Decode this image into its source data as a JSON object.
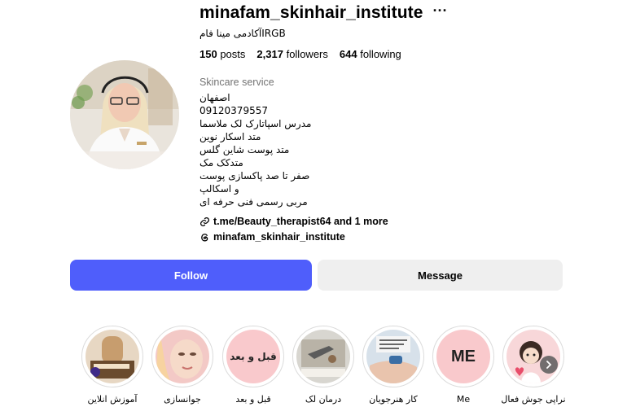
{
  "profile": {
    "username": "minafam_skinhair_institute",
    "full_name": "آکادمی مینا فامIRGB",
    "stats": {
      "posts_count": "150",
      "posts_label": "posts",
      "followers_count": "2,317",
      "followers_label": "followers",
      "following_count": "644",
      "following_label": "following"
    },
    "category": "Skincare service",
    "bio_lines": [
      "اصفهان",
      "09120379557",
      "مدرس اسپاتارک لک ملاسما",
      "متد اسکار نوین",
      "متد پوست شاین گلس",
      "متدکک مک",
      "صفر تا صد پاکسازی پوست",
      "و اسکالپ",
      "مربی رسمی فنی حرفه ای"
    ],
    "link_text": "t.me/Beauty_therapist64 and 1 more",
    "threads_handle": "minafam_skinhair_institute"
  },
  "actions": {
    "follow_label": "Follow",
    "message_label": "Message"
  },
  "highlights": [
    {
      "label": "آموزش انلاین"
    },
    {
      "label": "جوانسازی"
    },
    {
      "label": "قبل و بعد",
      "cover_text": "قبل و بعد"
    },
    {
      "label": "درمان لک"
    },
    {
      "label": "کار هنرجویان"
    },
    {
      "label": "Me",
      "cover_text": "ME"
    },
    {
      "label": "نراپی جوش فعال"
    }
  ],
  "icons": {
    "more": "more-options-icon",
    "link": "link-icon",
    "threads": "threads-icon",
    "next": "chevron-right-icon"
  },
  "colors": {
    "follow_button": "#4f5efb",
    "message_button": "#efefef",
    "secondary_text": "#737373",
    "highlight_pink": "#f9c9cc"
  }
}
